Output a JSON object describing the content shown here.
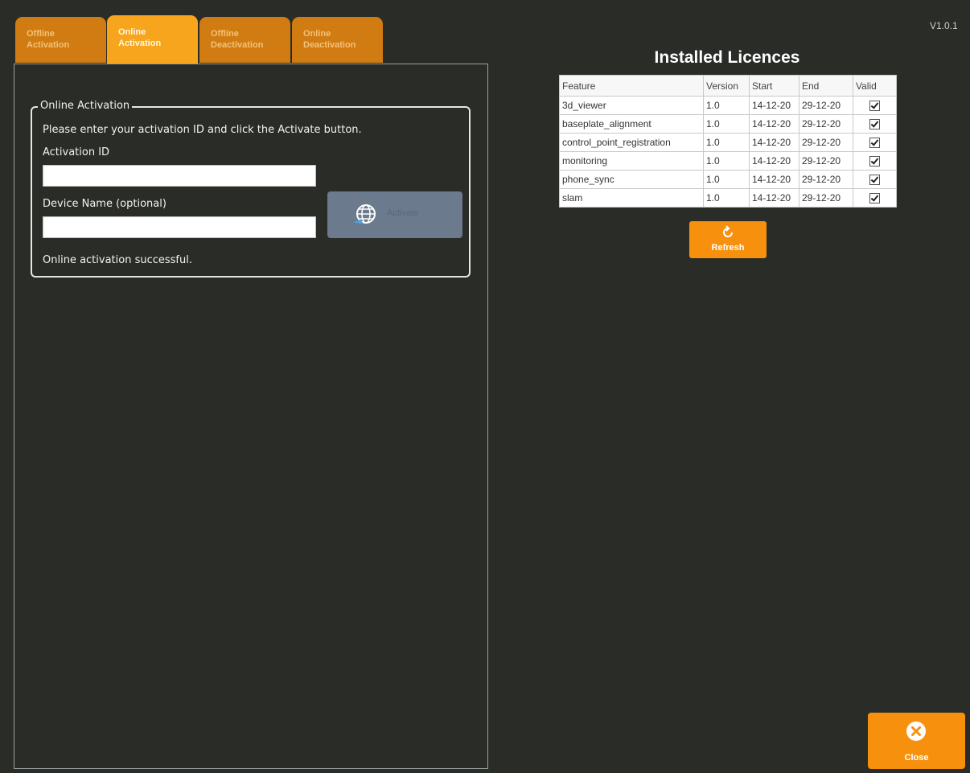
{
  "version": "V1.0.1",
  "tabs": [
    {
      "line1": "Offline",
      "line2": "Activation"
    },
    {
      "line1": "Online",
      "line2": "Activation"
    },
    {
      "line1": "Offline",
      "line2": "Deactivation"
    },
    {
      "line1": "Online",
      "line2": "Deactivation"
    }
  ],
  "active_tab": "Online Activation",
  "online_activation": {
    "group_title": "Online Activation",
    "instruction": "Please enter your activation ID and click the Activate button.",
    "activation_id_label": "Activation ID",
    "activation_id_value": "",
    "device_name_label": "Device Name (optional)",
    "device_name_value": "",
    "activate_label": "Activate",
    "status": "Online activation successful."
  },
  "licences": {
    "title": "Installed Licences",
    "headers": {
      "feature": "Feature",
      "version": "Version",
      "start": "Start",
      "end": "End",
      "valid": "Valid"
    },
    "rows": [
      {
        "feature": "3d_viewer",
        "version": "1.0",
        "start": "14-12-20",
        "end": "29-12-20",
        "valid": true
      },
      {
        "feature": "baseplate_alignment",
        "version": "1.0",
        "start": "14-12-20",
        "end": "29-12-20",
        "valid": true
      },
      {
        "feature": "control_point_registration",
        "version": "1.0",
        "start": "14-12-20",
        "end": "29-12-20",
        "valid": true
      },
      {
        "feature": "monitoring",
        "version": "1.0",
        "start": "14-12-20",
        "end": "29-12-20",
        "valid": true
      },
      {
        "feature": "phone_sync",
        "version": "1.0",
        "start": "14-12-20",
        "end": "29-12-20",
        "valid": true
      },
      {
        "feature": "slam",
        "version": "1.0",
        "start": "14-12-20",
        "end": "29-12-20",
        "valid": true
      }
    ]
  },
  "refresh_label": "Refresh",
  "close_label": "Close",
  "colors": {
    "background": "#2a2c28",
    "tab": "#d07c12",
    "tab_active": "#f7a51d",
    "button_orange": "#f7910d",
    "activate_disabled": "#6b7a8c"
  }
}
